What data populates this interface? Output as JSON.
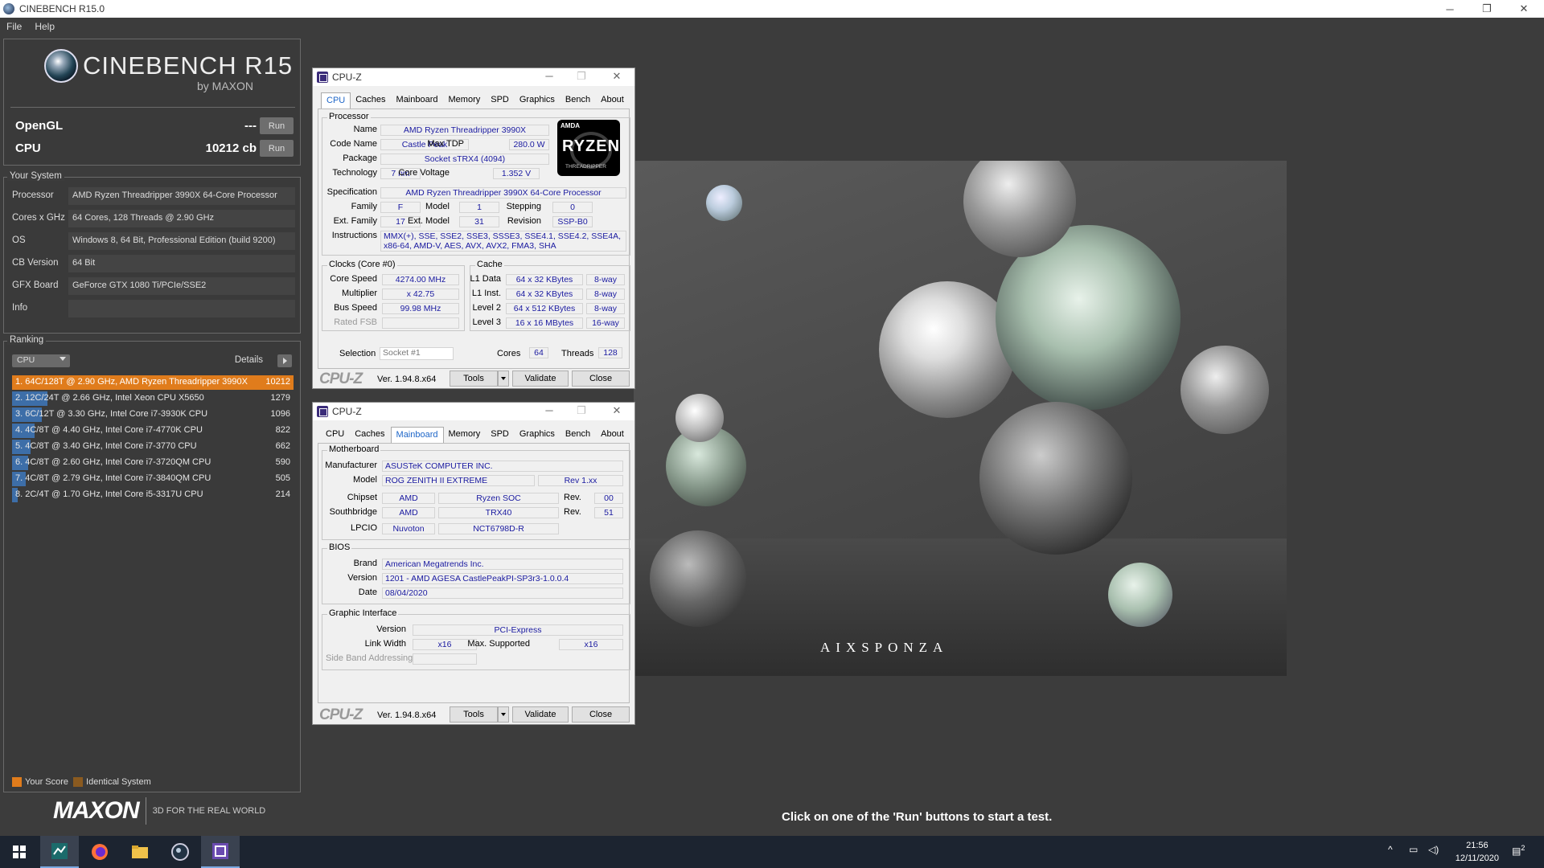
{
  "window": {
    "title": "CINEBENCH R15.0",
    "minimize": "─",
    "maximize": "❐",
    "close": "✕"
  },
  "menu": [
    "File",
    "Help"
  ],
  "logo": {
    "name": "CINEBENCH R15",
    "sub": "by MAXON"
  },
  "tests": {
    "opengl": {
      "label": "OpenGL",
      "value": "---",
      "run": "Run"
    },
    "cpu": {
      "label": "CPU",
      "value": "10212 cb",
      "run": "Run"
    }
  },
  "system": {
    "title": "Your System",
    "rows": [
      {
        "key": "Processor",
        "value": "AMD Ryzen Threadripper 3990X 64-Core Processor"
      },
      {
        "key": "Cores x GHz",
        "value": "64 Cores, 128 Threads @ 2.90 GHz"
      },
      {
        "key": "OS",
        "value": "Windows 8, 64 Bit, Professional Edition (build 9200)"
      },
      {
        "key": "CB Version",
        "value": "64 Bit"
      },
      {
        "key": "GFX Board",
        "value": "GeForce GTX 1080 Ti/PCIe/SSE2"
      },
      {
        "key": "Info",
        "value": ""
      }
    ]
  },
  "ranking": {
    "title": "Ranking",
    "select": "CPU",
    "details": "Details",
    "rows": [
      {
        "text": "1. 64C/128T @ 2.90 GHz, AMD Ryzen Threadripper 3990X 6",
        "score": "10212",
        "fraction": 1.0,
        "mine": true
      },
      {
        "text": "2. 12C/24T @ 2.66 GHz, Intel Xeon CPU X5650",
        "score": "1279",
        "fraction": 0.125
      },
      {
        "text": "3. 6C/12T @ 3.30 GHz,  Intel Core i7-3930K CPU",
        "score": "1096",
        "fraction": 0.107
      },
      {
        "text": "4. 4C/8T @ 4.40 GHz, Intel Core i7-4770K CPU",
        "score": "822",
        "fraction": 0.08
      },
      {
        "text": "5. 4C/8T @ 3.40 GHz,  Intel Core i7-3770 CPU",
        "score": "662",
        "fraction": 0.065
      },
      {
        "text": "6. 4C/8T @ 2.60 GHz, Intel Core i7-3720QM CPU",
        "score": "590",
        "fraction": 0.058
      },
      {
        "text": "7. 4C/8T @ 2.79 GHz,  Intel Core i7-3840QM CPU",
        "score": "505",
        "fraction": 0.049
      },
      {
        "text": "8. 2C/4T @ 1.70 GHz,  Intel Core i5-3317U CPU",
        "score": "214",
        "fraction": 0.021
      }
    ],
    "legend": {
      "your_score": "Your Score",
      "identical": "Identical System",
      "your_color": "#e07c1c",
      "identical_color": "#8a5a20"
    }
  },
  "brand": {
    "maxon": "MAXON",
    "tagline": "3D FOR THE REAL WORLD"
  },
  "hint": "Click on one of the 'Run' buttons to start a test.",
  "render_watermark": "AIXSPONZA",
  "cpuz_cpu": {
    "title": "CPU-Z",
    "tabs": [
      "CPU",
      "Caches",
      "Mainboard",
      "Memory",
      "SPD",
      "Graphics",
      "Bench",
      "About"
    ],
    "active_tab": "CPU",
    "processor": {
      "group": "Processor",
      "name_label": "Name",
      "name": "AMD Ryzen Threadripper 3990X",
      "codename_label": "Code Name",
      "codename": "Castle Peak",
      "maxtdp_label": "Max TDP",
      "maxtdp": "280.0 W",
      "package_label": "Package",
      "package": "Socket sTRX4 (4094)",
      "tech_label": "Technology",
      "tech": "7 nm",
      "voltage_label": "Core Voltage",
      "voltage": "1.352 V",
      "spec_label": "Specification",
      "spec": "AMD Ryzen Threadripper 3990X 64-Core Processor",
      "family_label": "Family",
      "family": "F",
      "model_label": "Model",
      "model": "1",
      "stepping_label": "Stepping",
      "stepping": "0",
      "extfamily_label": "Ext. Family",
      "extfamily": "17",
      "extmodel_label": "Ext. Model",
      "extmodel": "31",
      "revision_label": "Revision",
      "revision": "SSP-B0",
      "instr_label": "Instructions",
      "instr": "MMX(+), SSE, SSE2, SSE3, SSSE3, SSE4.1, SSE4.2, SSE4A, x86-64, AMD-V, AES, AVX, AVX2, FMA3, SHA",
      "badge_brand": "AMDA",
      "badge_name": "RYZEN",
      "badge_sub": "THREADRIPPER"
    },
    "clocks": {
      "group": "Clocks (Core #0)",
      "corespeed_label": "Core Speed",
      "corespeed": "4274.00 MHz",
      "mult_label": "Multiplier",
      "mult": "x 42.75",
      "bus_label": "Bus Speed",
      "bus": "99.98 MHz",
      "fsb_label": "Rated FSB",
      "fsb": ""
    },
    "cache": {
      "group": "Cache",
      "rows": [
        {
          "label": "L1 Data",
          "size": "64 x 32 KBytes",
          "way": "8-way"
        },
        {
          "label": "L1 Inst.",
          "size": "64 x 32 KBytes",
          "way": "8-way"
        },
        {
          "label": "Level 2",
          "size": "64 x 512 KBytes",
          "way": "8-way"
        },
        {
          "label": "Level 3",
          "size": "16 x 16 MBytes",
          "way": "16-way"
        }
      ]
    },
    "selection_label": "Selection",
    "selection": "Socket #1",
    "cores_label": "Cores",
    "cores": "64",
    "threads_label": "Threads",
    "threads": "128",
    "footer": {
      "logo": "CPU-Z",
      "version": "Ver. 1.94.8.x64",
      "tools": "Tools",
      "validate": "Validate",
      "close": "Close"
    }
  },
  "cpuz_mb": {
    "title": "CPU-Z",
    "tabs": [
      "CPU",
      "Caches",
      "Mainboard",
      "Memory",
      "SPD",
      "Graphics",
      "Bench",
      "About"
    ],
    "active_tab": "Mainboard",
    "motherboard": {
      "group": "Motherboard",
      "manufacturer_label": "Manufacturer",
      "manufacturer": "ASUSTeK COMPUTER INC.",
      "model_label": "Model",
      "model": "ROG ZENITH II EXTREME",
      "model_rev": "Rev 1.xx",
      "chipset_label": "Chipset",
      "chipset_vendor": "AMD",
      "chipset": "Ryzen SOC",
      "chipset_rev_label": "Rev.",
      "chipset_rev": "00",
      "south_label": "Southbridge",
      "south_vendor": "AMD",
      "south": "TRX40",
      "south_rev_label": "Rev.",
      "south_rev": "51",
      "lpcio_label": "LPCIO",
      "lpcio_vendor": "Nuvoton",
      "lpcio": "NCT6798D-R"
    },
    "bios": {
      "group": "BIOS",
      "brand_label": "Brand",
      "brand": "American Megatrends Inc.",
      "version_label": "Version",
      "version": "1201 - AMD AGESA CastlePeakPI-SP3r3-1.0.0.4",
      "date_label": "Date",
      "date": "08/04/2020"
    },
    "graphic": {
      "group": "Graphic Interface",
      "version_label": "Version",
      "version": "PCI-Express",
      "width_label": "Link Width",
      "width": "x16",
      "max_label": "Max. Supported",
      "max": "x16",
      "sba_label": "Side Band Addressing",
      "sba": ""
    },
    "footer": {
      "logo": "CPU-Z",
      "version": "Ver. 1.94.8.x64",
      "tools": "Tools",
      "validate": "Validate",
      "close": "Close"
    }
  },
  "taskbar": {
    "time": "21:56",
    "date": "12/11/2020",
    "notification_count": "2"
  }
}
